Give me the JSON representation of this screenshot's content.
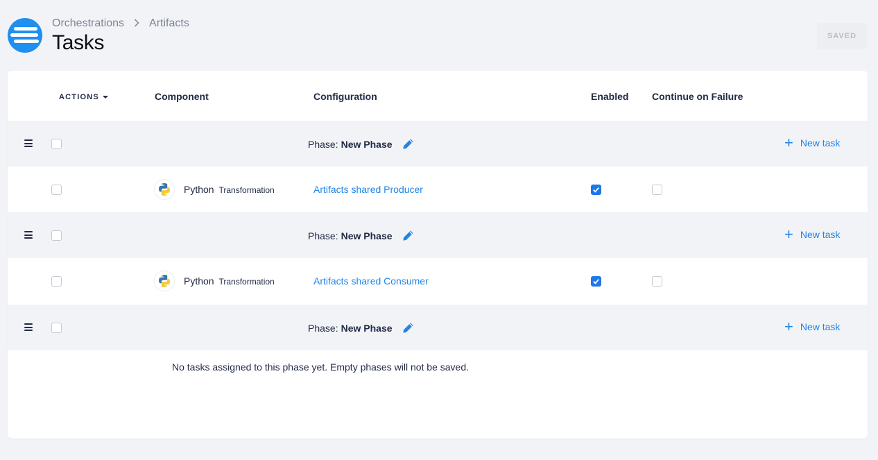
{
  "header": {
    "breadcrumb": [
      "Orchestrations",
      "Artifacts"
    ],
    "title": "Tasks",
    "saved_label": "SAVED"
  },
  "table": {
    "columns": {
      "actions": "ACTIONS",
      "component": "Component",
      "configuration": "Configuration",
      "enabled": "Enabled",
      "continue_on_failure": "Continue on Failure"
    },
    "phase_prefix": "Phase:",
    "new_task_label": "New task",
    "phases": [
      {
        "name": "New Phase",
        "tasks": [
          {
            "component": "Python",
            "component_type": "Transformation",
            "configuration": "Artifacts shared Producer",
            "enabled": true,
            "continue_on_failure": false
          }
        ]
      },
      {
        "name": "New Phase",
        "tasks": [
          {
            "component": "Python",
            "component_type": "Transformation",
            "configuration": "Artifacts shared Consumer",
            "enabled": true,
            "continue_on_failure": false
          }
        ]
      },
      {
        "name": "New Phase",
        "tasks": [],
        "empty_message": "No tasks assigned to this phase yet. Empty phases will not be saved."
      }
    ]
  },
  "colors": {
    "accent": "#1f86e8",
    "logo": "#1f8ff0",
    "phase_bg": "#f2f3f7"
  },
  "icons": [
    "keboola-logo-icon",
    "chevron-right-icon",
    "caret-down-icon",
    "drag-handle-icon",
    "pencil-icon",
    "plus-icon",
    "python-icon",
    "checkmark-icon"
  ]
}
